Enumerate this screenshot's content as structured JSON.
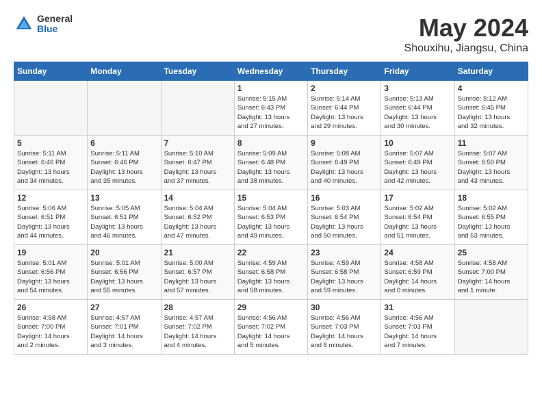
{
  "logo": {
    "general": "General",
    "blue": "Blue"
  },
  "title": "May 2024",
  "subtitle": "Shouxihu, Jiangsu, China",
  "weekdays": [
    "Sunday",
    "Monday",
    "Tuesday",
    "Wednesday",
    "Thursday",
    "Friday",
    "Saturday"
  ],
  "weeks": [
    [
      {
        "day": "",
        "info": ""
      },
      {
        "day": "",
        "info": ""
      },
      {
        "day": "",
        "info": ""
      },
      {
        "day": "1",
        "info": "Sunrise: 5:15 AM\nSunset: 6:43 PM\nDaylight: 13 hours\nand 27 minutes."
      },
      {
        "day": "2",
        "info": "Sunrise: 5:14 AM\nSunset: 6:44 PM\nDaylight: 13 hours\nand 29 minutes."
      },
      {
        "day": "3",
        "info": "Sunrise: 5:13 AM\nSunset: 6:44 PM\nDaylight: 13 hours\nand 30 minutes."
      },
      {
        "day": "4",
        "info": "Sunrise: 5:12 AM\nSunset: 6:45 PM\nDaylight: 13 hours\nand 32 minutes."
      }
    ],
    [
      {
        "day": "5",
        "info": "Sunrise: 5:11 AM\nSunset: 6:46 PM\nDaylight: 13 hours\nand 34 minutes."
      },
      {
        "day": "6",
        "info": "Sunrise: 5:11 AM\nSunset: 6:46 PM\nDaylight: 13 hours\nand 35 minutes."
      },
      {
        "day": "7",
        "info": "Sunrise: 5:10 AM\nSunset: 6:47 PM\nDaylight: 13 hours\nand 37 minutes."
      },
      {
        "day": "8",
        "info": "Sunrise: 5:09 AM\nSunset: 6:48 PM\nDaylight: 13 hours\nand 38 minutes."
      },
      {
        "day": "9",
        "info": "Sunrise: 5:08 AM\nSunset: 6:49 PM\nDaylight: 13 hours\nand 40 minutes."
      },
      {
        "day": "10",
        "info": "Sunrise: 5:07 AM\nSunset: 6:49 PM\nDaylight: 13 hours\nand 42 minutes."
      },
      {
        "day": "11",
        "info": "Sunrise: 5:07 AM\nSunset: 6:50 PM\nDaylight: 13 hours\nand 43 minutes."
      }
    ],
    [
      {
        "day": "12",
        "info": "Sunrise: 5:06 AM\nSunset: 6:51 PM\nDaylight: 13 hours\nand 44 minutes."
      },
      {
        "day": "13",
        "info": "Sunrise: 5:05 AM\nSunset: 6:51 PM\nDaylight: 13 hours\nand 46 minutes."
      },
      {
        "day": "14",
        "info": "Sunrise: 5:04 AM\nSunset: 6:52 PM\nDaylight: 13 hours\nand 47 minutes."
      },
      {
        "day": "15",
        "info": "Sunrise: 5:04 AM\nSunset: 6:53 PM\nDaylight: 13 hours\nand 49 minutes."
      },
      {
        "day": "16",
        "info": "Sunrise: 5:03 AM\nSunset: 6:54 PM\nDaylight: 13 hours\nand 50 minutes."
      },
      {
        "day": "17",
        "info": "Sunrise: 5:02 AM\nSunset: 6:54 PM\nDaylight: 13 hours\nand 51 minutes."
      },
      {
        "day": "18",
        "info": "Sunrise: 5:02 AM\nSunset: 6:55 PM\nDaylight: 13 hours\nand 53 minutes."
      }
    ],
    [
      {
        "day": "19",
        "info": "Sunrise: 5:01 AM\nSunset: 6:56 PM\nDaylight: 13 hours\nand 54 minutes."
      },
      {
        "day": "20",
        "info": "Sunrise: 5:01 AM\nSunset: 6:56 PM\nDaylight: 13 hours\nand 55 minutes."
      },
      {
        "day": "21",
        "info": "Sunrise: 5:00 AM\nSunset: 6:57 PM\nDaylight: 13 hours\nand 57 minutes."
      },
      {
        "day": "22",
        "info": "Sunrise: 4:59 AM\nSunset: 6:58 PM\nDaylight: 13 hours\nand 58 minutes."
      },
      {
        "day": "23",
        "info": "Sunrise: 4:59 AM\nSunset: 6:58 PM\nDaylight: 13 hours\nand 59 minutes."
      },
      {
        "day": "24",
        "info": "Sunrise: 4:58 AM\nSunset: 6:59 PM\nDaylight: 14 hours\nand 0 minutes."
      },
      {
        "day": "25",
        "info": "Sunrise: 4:58 AM\nSunset: 7:00 PM\nDaylight: 14 hours\nand 1 minute."
      }
    ],
    [
      {
        "day": "26",
        "info": "Sunrise: 4:58 AM\nSunset: 7:00 PM\nDaylight: 14 hours\nand 2 minutes."
      },
      {
        "day": "27",
        "info": "Sunrise: 4:57 AM\nSunset: 7:01 PM\nDaylight: 14 hours\nand 3 minutes."
      },
      {
        "day": "28",
        "info": "Sunrise: 4:57 AM\nSunset: 7:02 PM\nDaylight: 14 hours\nand 4 minutes."
      },
      {
        "day": "29",
        "info": "Sunrise: 4:56 AM\nSunset: 7:02 PM\nDaylight: 14 hours\nand 5 minutes."
      },
      {
        "day": "30",
        "info": "Sunrise: 4:56 AM\nSunset: 7:03 PM\nDaylight: 14 hours\nand 6 minutes."
      },
      {
        "day": "31",
        "info": "Sunrise: 4:56 AM\nSunset: 7:03 PM\nDaylight: 14 hours\nand 7 minutes."
      },
      {
        "day": "",
        "info": ""
      }
    ]
  ]
}
